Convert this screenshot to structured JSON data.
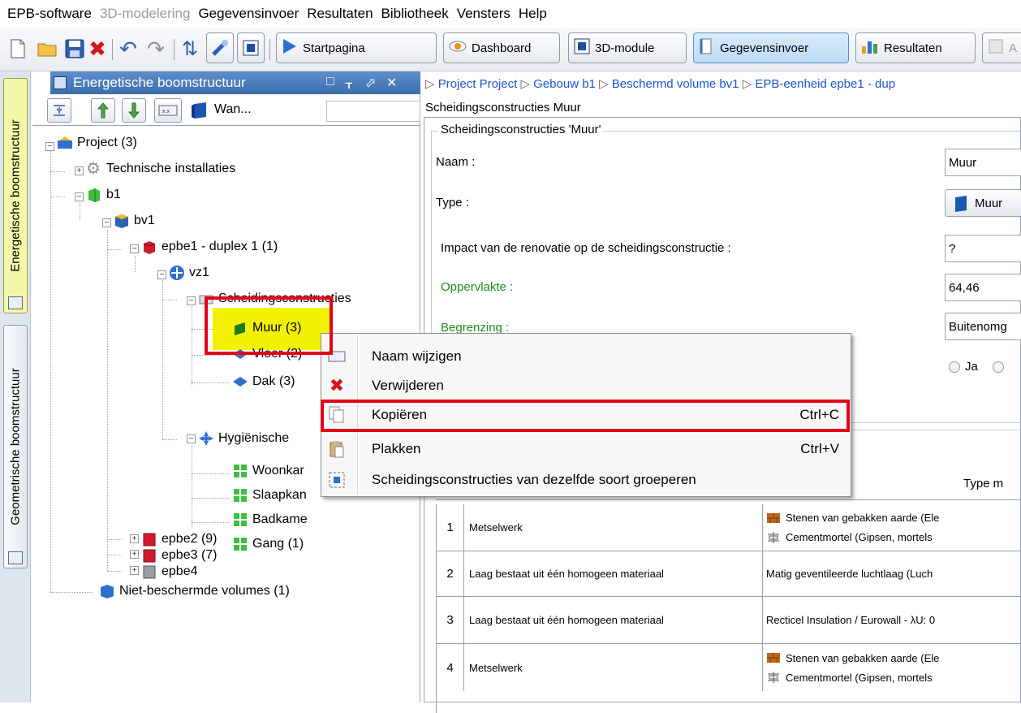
{
  "menubar": {
    "items": [
      {
        "label": "EPB-software",
        "disabled": false
      },
      {
        "label": "3D-modelering",
        "disabled": true
      },
      {
        "label": "Gegevensinvoer",
        "disabled": false
      },
      {
        "label": "Resultaten",
        "disabled": false
      },
      {
        "label": "Bibliotheek",
        "disabled": false
      },
      {
        "label": "Vensters",
        "disabled": false
      },
      {
        "label": "Help",
        "disabled": false
      }
    ]
  },
  "toolbar": {
    "icons": [
      "new-file-icon",
      "open-folder-icon",
      "save-icon",
      "close-icon",
      "undo-icon",
      "redo-icon",
      "refresh-icon",
      "pointer-icon",
      "window-icon"
    ],
    "buttons": [
      {
        "label": "Startpagina",
        "icon": "play-icon"
      },
      {
        "label": "Dashboard",
        "icon": "eye-icon"
      },
      {
        "label": "3D-module",
        "icon": "window-icon"
      },
      {
        "label": "Gegevensinvoer",
        "icon": "data-entry-icon"
      },
      {
        "label": "Resultaten",
        "icon": "bar-chart-icon"
      },
      {
        "label": "A",
        "icon": "pencil-icon"
      }
    ]
  },
  "side_tabs": {
    "energy": "Energetische boomstructuur",
    "geometric": "Geometrische boomstructuur"
  },
  "tree_panel": {
    "title": "Energetische boomstructuur",
    "title_controls": [
      "□",
      "ᚁ",
      "⬀",
      "✕"
    ],
    "dropdown_value": "Wan..."
  },
  "tree": {
    "project": "Project (3)",
    "technische": "Technische installaties",
    "b1": "b1",
    "bv1": "bv1",
    "epbe1": "epbe1 - duplex 1 (1)",
    "vz1": "vz1",
    "scheidings": "Scheidingsconstructies",
    "muur": "Muur (3)",
    "vloer": "Vloer (2)",
    "dak": "Dak (3)",
    "hygienische": "Hygiënische",
    "woonkamer": "Woonkar",
    "slaapkamer": "Slaapkan",
    "badkamer": "Badkame",
    "gang": "Gang (1)",
    "epbe2": "epbe2  (9)",
    "epbe3": "epbe3 (7)",
    "epbe4": "epbe4",
    "niet": "Niet-beschermde volumes (1)"
  },
  "breadcrumb": [
    "Project Project",
    "Gebouw b1",
    "Beschermd volume bv1",
    "EPB-eenheid epbe1 - dup"
  ],
  "subtitle": "Scheidingsconstructies Muur",
  "form": {
    "group_title": "Scheidingsconstructies 'Muur'",
    "naam_label": "Naam :",
    "naam_value": "Muur",
    "type_label": "Type :",
    "type_value": "Muur",
    "impact_label": "Impact van de renovatie op de scheidingsconstructie :",
    "impact_value": "?",
    "oppervlakte_label": "Oppervlakte :",
    "oppervlakte_value": "64,46",
    "begrenzing_label": "Begrenzing  :",
    "begrenzing_value": "Buitenomg",
    "radio_ja": "Ja"
  },
  "table": {
    "type_header": "Type m",
    "rows": [
      {
        "num": "1",
        "desc": "Metselwerk",
        "materials": [
          {
            "icon": "brick-icon",
            "text": "Stenen van gebakken aarde (Ele"
          },
          {
            "icon": "mortar-icon",
            "text": "Cementmortel (Gipsen, mortels"
          }
        ]
      },
      {
        "num": "2",
        "desc": "Laag bestaat uit één homogeen materiaal",
        "materials": [
          {
            "icon": "",
            "text": "Matig geventileerde luchtlaag (Luch"
          }
        ]
      },
      {
        "num": "3",
        "desc": "Laag bestaat uit één homogeen materiaal",
        "materials": [
          {
            "icon": "",
            "text": "Recticel Insulation / Eurowall - λU: 0"
          }
        ]
      },
      {
        "num": "4",
        "desc": "Metselwerk",
        "materials": [
          {
            "icon": "brick-icon",
            "text": "Stenen van gebakken aarde (Ele"
          },
          {
            "icon": "mortar-icon",
            "text": "Cementmortel (Gipsen, mortels"
          }
        ]
      }
    ]
  },
  "context_menu": {
    "items": [
      {
        "label": "Naam wijzigen",
        "shortcut": "",
        "icon": "rename-icon"
      },
      {
        "label": "Verwijderen",
        "shortcut": "",
        "icon": "delete-icon"
      },
      {
        "label": "Kopiëren",
        "shortcut": "Ctrl+C",
        "icon": "copy-icon"
      },
      {
        "label": "Plakken",
        "shortcut": "Ctrl+V",
        "icon": "paste-icon"
      },
      {
        "label": "Scheidingsconstructies van dezelfde soort groeperen",
        "shortcut": "",
        "icon": "group-icon"
      }
    ]
  },
  "colors": {
    "highlight_red": "#e3001b",
    "selection_yellow": "#f2f200",
    "title_blue": "#3b6eae",
    "link_blue": "#1a56c9",
    "label_green": "#1f8a1f"
  }
}
